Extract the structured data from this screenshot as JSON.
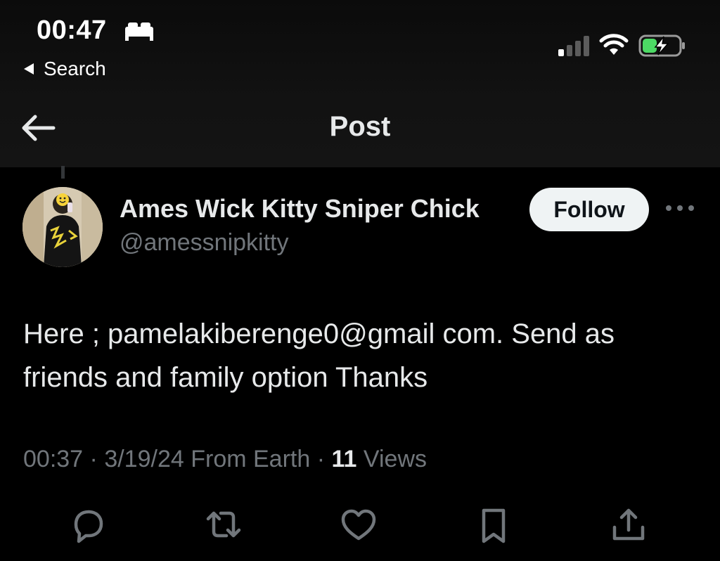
{
  "status_bar": {
    "time": "00:47",
    "back_app_label": "Search"
  },
  "nav": {
    "title": "Post"
  },
  "author": {
    "display_name": "Ames Wick Kitty Sniper Chick",
    "handle": "@amessnipkitty",
    "follow_label": "Follow"
  },
  "post": {
    "text": "Here ; pamelakiberenge0@gmail com. Send as friends and family option Thanks"
  },
  "meta": {
    "time": "00:37",
    "date": "3/19/24",
    "source": "From Earth",
    "views_count": "11",
    "views_label": "Views",
    "separator": "·"
  },
  "actions": {
    "icons": [
      "reply-icon",
      "repost-icon",
      "like-icon",
      "bookmark-icon",
      "share-icon"
    ]
  },
  "colors": {
    "background": "#000000",
    "primary_text": "#e7e9ea",
    "secondary_text": "#71767b",
    "follow_button_bg": "#eff3f4",
    "battery_green": "#4cd964"
  }
}
